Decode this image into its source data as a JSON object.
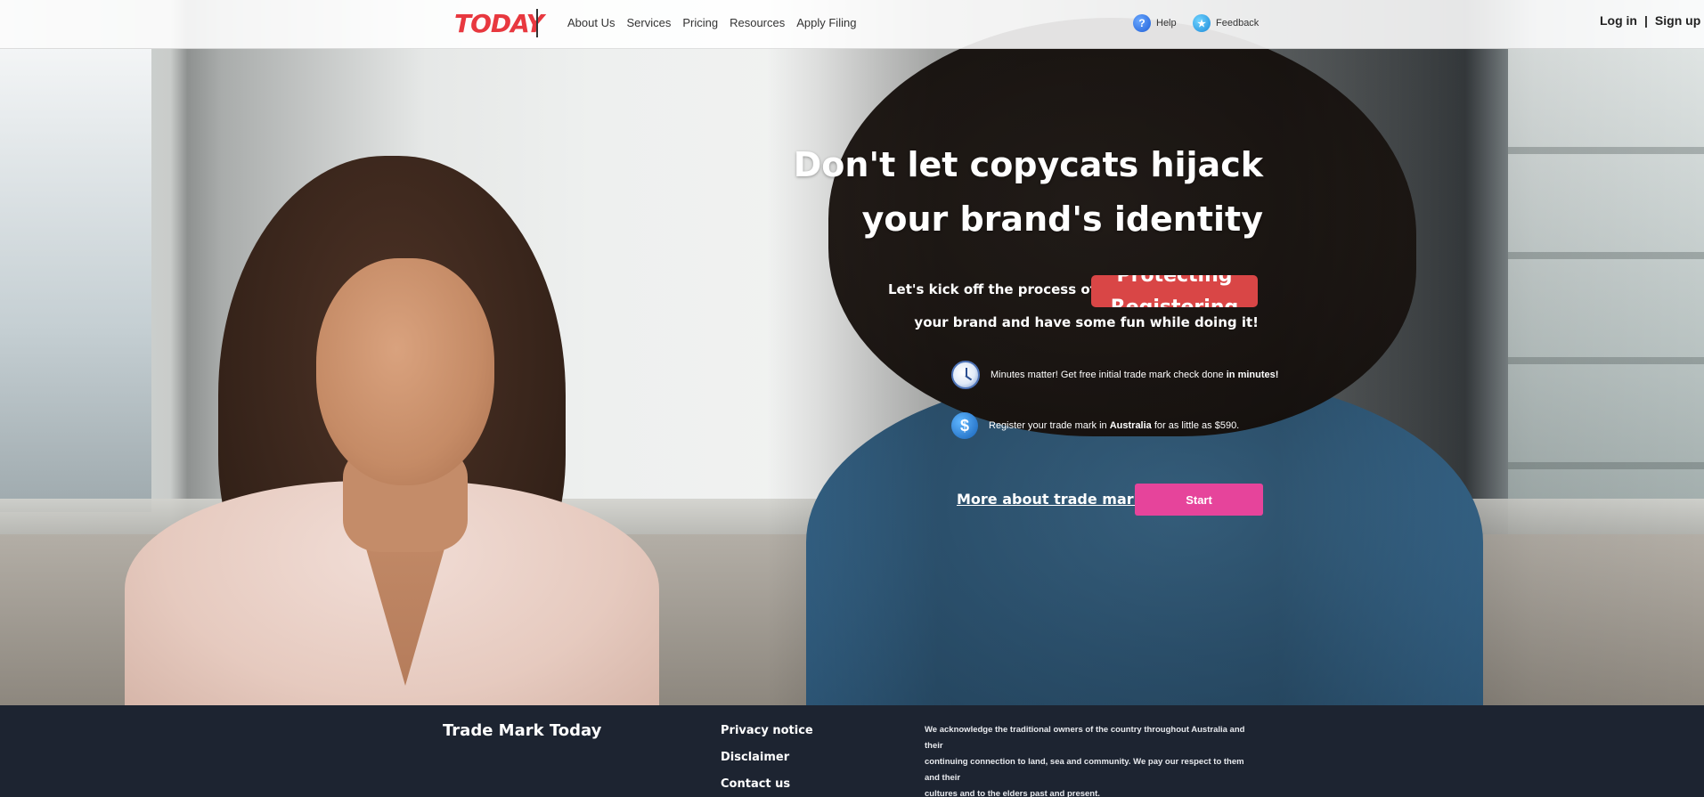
{
  "header": {
    "logo_text": "TODAY",
    "nav": [
      "About Us",
      "Services",
      "Pricing",
      "Resources",
      "Apply Filing"
    ],
    "help_label": "Help",
    "feedback_label": "Feedback",
    "login_label": "Log in",
    "auth_separator": "|",
    "signup_label": "Sign up"
  },
  "hero": {
    "headline_line1": "Don't let copycats hijack",
    "headline_line2": "your brand's identity",
    "kickoff_text": "Let's kick off the process of",
    "rotator_words": [
      "Protecting",
      "Registering"
    ],
    "tagline": "your brand and have some fun while doing it!",
    "features": [
      {
        "icon": "clock-icon",
        "text_before": "Minutes matter! Get free initial trade mark check done ",
        "text_bold": "in minutes!",
        "text_after": ""
      },
      {
        "icon": "dollar-icon",
        "text_before": "Register your trade mark in ",
        "text_bold": "Australia",
        "text_after": " for as little as $590."
      }
    ],
    "more_link": "More about trade marks",
    "start_button": "Start",
    "colors": {
      "rotator_bg": "#d94646",
      "start_bg": "#e6449b"
    }
  },
  "footer": {
    "brand": "Trade Mark Today",
    "links": [
      "Privacy notice",
      "Disclaimer",
      "Contact us"
    ],
    "acknowledgement_lines": [
      "We acknowledge the traditional owners of the country throughout Australia and their",
      "continuing connection to land, sea and community. We pay our respect to them and their",
      "cultures and to the elders past and present."
    ],
    "bg_color": "#1d2431"
  }
}
